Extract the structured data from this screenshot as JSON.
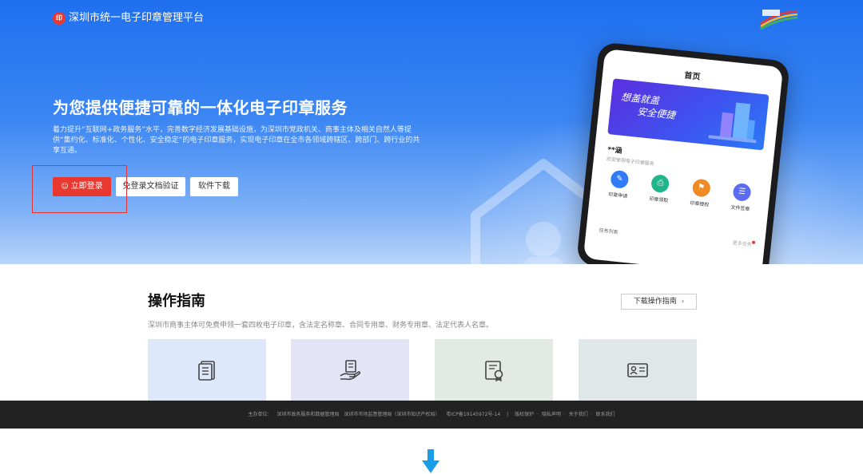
{
  "header": {
    "logo_mark": "印",
    "site_title": "深圳市统一电子印章管理平台"
  },
  "hero": {
    "title": "为您提供便捷可靠的一体化电子印章服务",
    "description": "着力提升“互联网+政务服务”水平，完善数字经济发展基础设施，为深圳市党政机关、商事主体及相关自然人等提供“集约化、标准化、个性化、安全稳定”的电子印章服务，实现电子印章在全市各领域跨辖区、跨部门、跨行业的共享互通。",
    "buttons": {
      "login": "立即登录",
      "verify": "免登录文档验证",
      "download": "软件下载"
    }
  },
  "phone": {
    "screen_title": "首页",
    "banner_line1": "想盖就盖",
    "banner_line2": "安全便捷",
    "user_name": "**涵",
    "welcome": "欢迎使用电子印章服务",
    "apps": [
      {
        "label": "印章申请",
        "color": "#2f7cf6",
        "icon": "seal-apply-icon"
      },
      {
        "label": "印章领取",
        "color": "#1fb58a",
        "icon": "seal-receive-icon"
      },
      {
        "label": "印章授权",
        "color": "#f08a24",
        "icon": "seal-authorize-icon"
      },
      {
        "label": "文件签章",
        "color": "#5b6cf0",
        "icon": "file-sign-icon"
      }
    ],
    "task_list": "任务列表",
    "task_more": "更多任务"
  },
  "guide": {
    "title": "操作指南",
    "description": "深圳市商事主体可免费申领一套四枚电子印章，含法定名称章、合同专用章、财务专用章、法定代表人名章。",
    "download_btn": "下载操作指南",
    "download_chevron": "›"
  },
  "footer": {
    "host_label": "主办单位：",
    "host1": "深圳市政务服务和数据管理局",
    "host2": "深圳市市场监督管理局（深圳市知识产权局）",
    "icp": "粤ICP备19145972号-14",
    "links": [
      "版权保护",
      "隐私声明",
      "关于我们",
      "联系我们"
    ]
  },
  "colors": {
    "accent_red": "#e8382f",
    "hero_blue": "#1f6ff0",
    "footer_bg": "#222222",
    "arrow_blue": "#1a9ee8"
  }
}
